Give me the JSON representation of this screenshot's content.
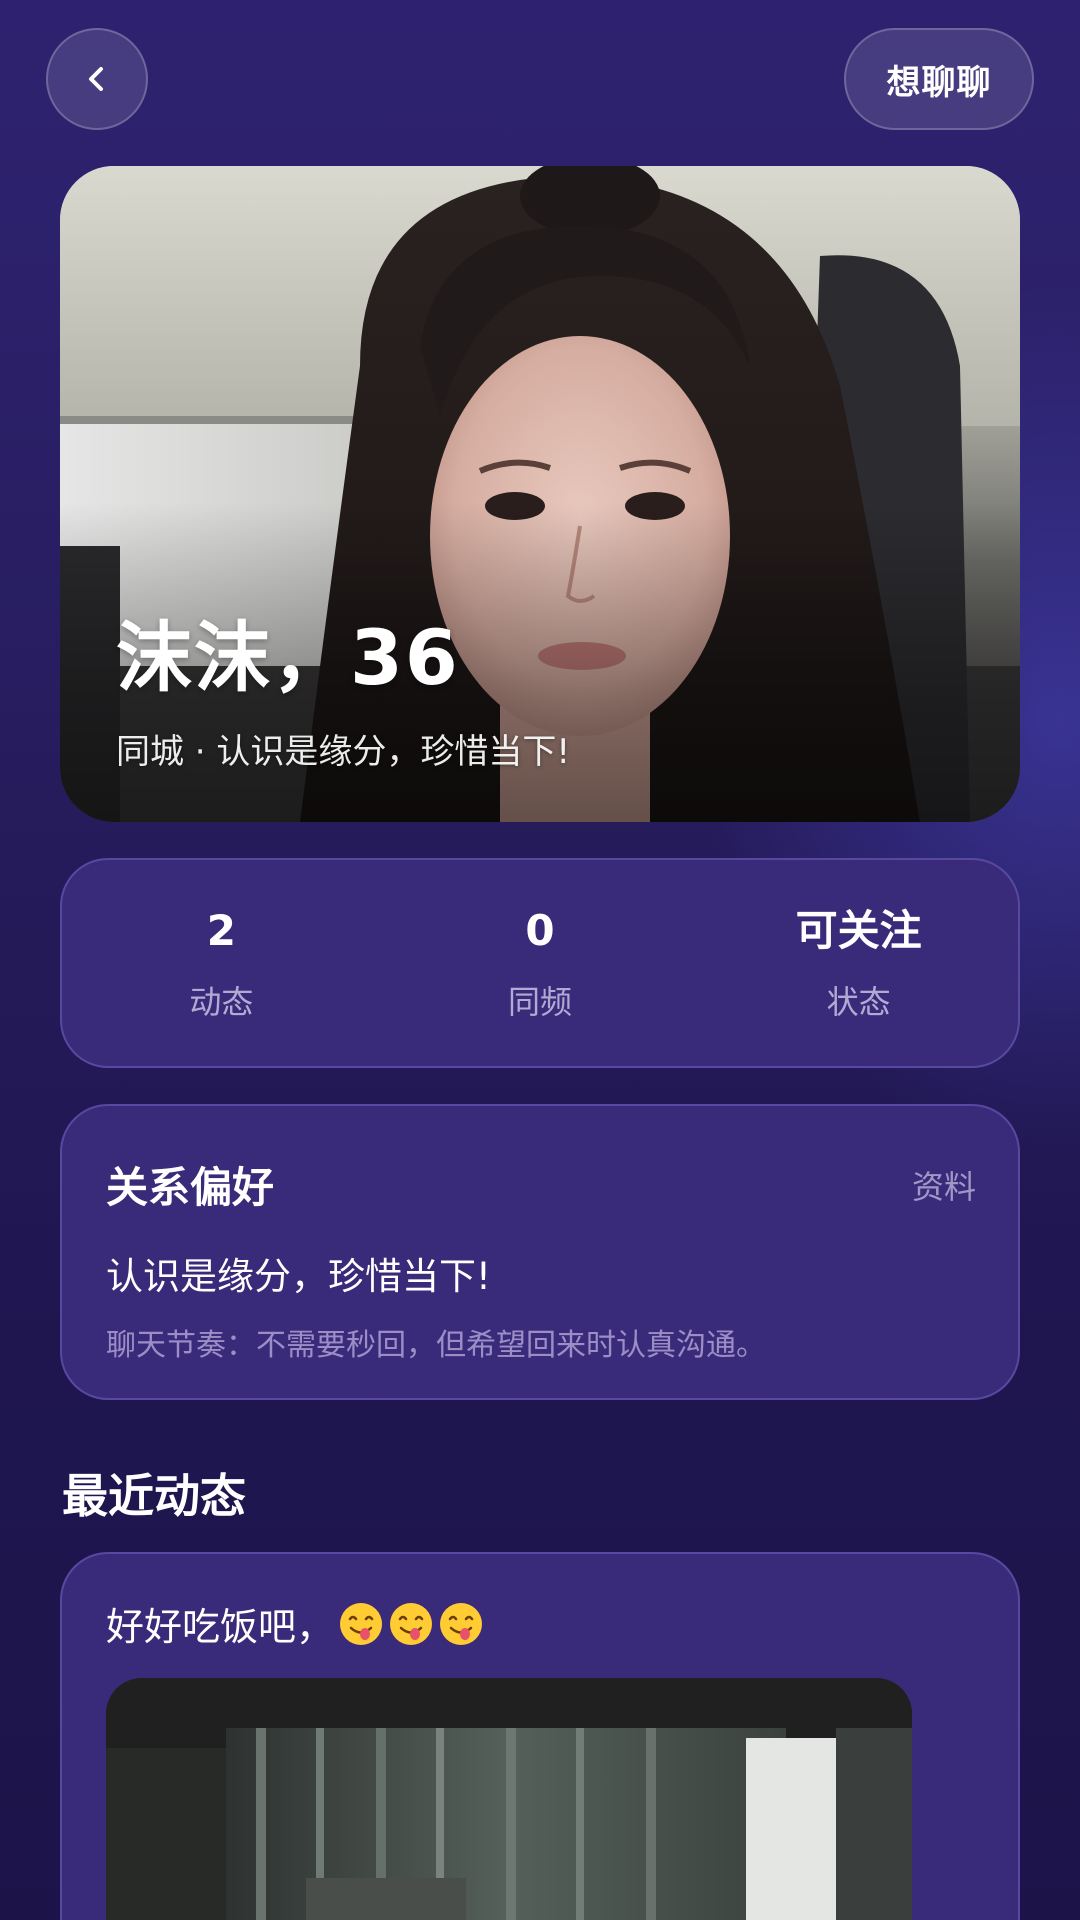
{
  "header": {
    "chat_button": "想聊聊"
  },
  "profile": {
    "name_age": "沫沫，36",
    "subtitle": "同城 · 认识是缘分，珍惜当下!"
  },
  "stats": [
    {
      "value": "2",
      "label": "动态"
    },
    {
      "value": "0",
      "label": "同频"
    },
    {
      "value": "可关注",
      "label": "状态"
    }
  ],
  "preference": {
    "title": "关系偏好",
    "link": "资料",
    "main": "认识是缘分，珍惜当下!",
    "note": "聊天节奏：不需要秒回，但希望回来时认真沟通。"
  },
  "recent": {
    "title": "最近动态",
    "posts": [
      {
        "text": "好好吃饭吧，",
        "emoji_count": 3,
        "emoji": "yum-face-icon"
      }
    ]
  },
  "colors": {
    "background": "#2b2068",
    "card": "#3a2a7a",
    "card_border": "#6a58c0"
  }
}
